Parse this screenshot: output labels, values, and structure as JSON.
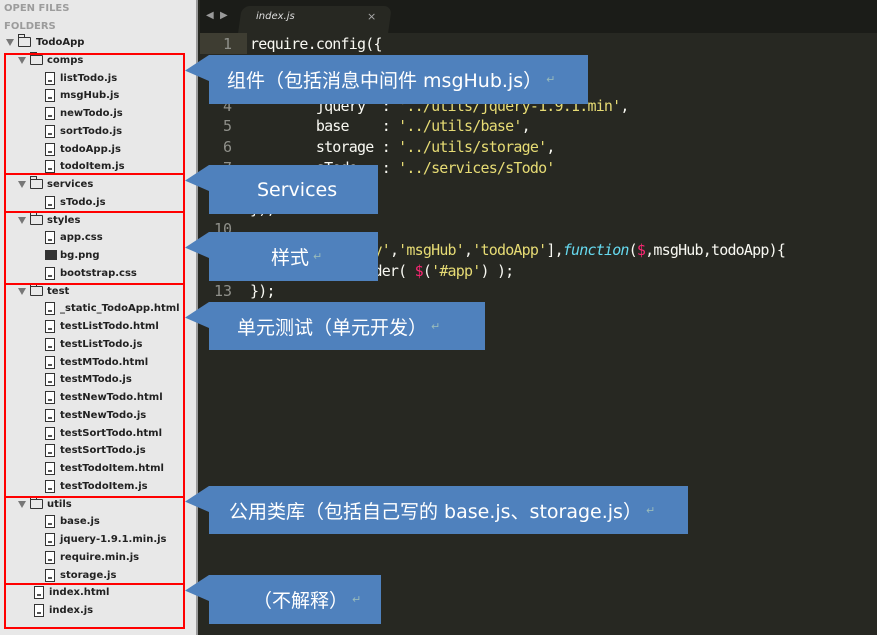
{
  "sidebar": {
    "open_files": "OPEN FILES",
    "folders": "FOLDERS",
    "tree": [
      {
        "name": "TodoApp",
        "type": "folder",
        "depth": 0
      },
      {
        "name": "comps",
        "type": "folder",
        "depth": 1
      },
      {
        "name": "listTodo.js",
        "type": "file",
        "depth": 2
      },
      {
        "name": "msgHub.js",
        "type": "file",
        "depth": 2
      },
      {
        "name": "newTodo.js",
        "type": "file",
        "depth": 2
      },
      {
        "name": "sortTodo.js",
        "type": "file",
        "depth": 2
      },
      {
        "name": "todoApp.js",
        "type": "file",
        "depth": 2
      },
      {
        "name": "todoItem.js",
        "type": "file",
        "depth": 2
      },
      {
        "name": "services",
        "type": "folder",
        "depth": 1
      },
      {
        "name": "sTodo.js",
        "type": "file",
        "depth": 2
      },
      {
        "name": "styles",
        "type": "folder",
        "depth": 1
      },
      {
        "name": "app.css",
        "type": "file",
        "depth": 2
      },
      {
        "name": "bg.png",
        "type": "image",
        "depth": 2
      },
      {
        "name": "bootstrap.css",
        "type": "file",
        "depth": 2
      },
      {
        "name": "test",
        "type": "folder",
        "depth": 1
      },
      {
        "name": "_static_TodoApp.html",
        "type": "file",
        "depth": 2
      },
      {
        "name": "testListTodo.html",
        "type": "file",
        "depth": 2
      },
      {
        "name": "testListTodo.js",
        "type": "file",
        "depth": 2
      },
      {
        "name": "testMTodo.html",
        "type": "file",
        "depth": 2
      },
      {
        "name": "testMTodo.js",
        "type": "file",
        "depth": 2
      },
      {
        "name": "testNewTodo.html",
        "type": "file",
        "depth": 2
      },
      {
        "name": "testNewTodo.js",
        "type": "file",
        "depth": 2
      },
      {
        "name": "testSortTodo.html",
        "type": "file",
        "depth": 2
      },
      {
        "name": "testSortTodo.js",
        "type": "file",
        "depth": 2
      },
      {
        "name": "testTodoItem.html",
        "type": "file",
        "depth": 2
      },
      {
        "name": "testTodoItem.js",
        "type": "file",
        "depth": 2
      },
      {
        "name": "utils",
        "type": "folder",
        "depth": 1
      },
      {
        "name": "base.js",
        "type": "file",
        "depth": 2
      },
      {
        "name": "jquery-1.9.1.min.js",
        "type": "file",
        "depth": 2
      },
      {
        "name": "require.min.js",
        "type": "file",
        "depth": 2
      },
      {
        "name": "storage.js",
        "type": "file",
        "depth": 2
      },
      {
        "name": "index.html",
        "type": "file",
        "depth": 1.5
      },
      {
        "name": "index.js",
        "type": "file",
        "depth": 1.5
      }
    ]
  },
  "editor": {
    "tab": "index.js",
    "close": "×",
    "nav_back": "◀",
    "nav_fwd": "▶",
    "lines": [
      {
        "n": "1",
        "t": [
          [
            "",
            "require.config({"
          ]
        ]
      },
      {
        "n": "2",
        "t": []
      },
      {
        "n": "3",
        "t": []
      },
      {
        "n": "4",
        "t": [
          [
            "",
            "        jquery  : "
          ],
          [
            "s",
            "'../utils/jquery-1.9.1.min'"
          ],
          [
            "",
            ","
          ]
        ]
      },
      {
        "n": "5",
        "t": [
          [
            "",
            "        base    : "
          ],
          [
            "s",
            "'../utils/base'"
          ],
          [
            "",
            ","
          ]
        ]
      },
      {
        "n": "6",
        "t": [
          [
            "",
            "        storage : "
          ],
          [
            "s",
            "'../utils/storage'"
          ],
          [
            "",
            ","
          ]
        ]
      },
      {
        "n": "7",
        "t": [
          [
            "",
            "        sTodo   : "
          ],
          [
            "s",
            "'../services/sTodo'"
          ]
        ]
      },
      {
        "n": "8",
        "t": []
      },
      {
        "n": "9",
        "t": [
          [
            "",
            "});"
          ]
        ]
      },
      {
        "n": "10",
        "t": []
      },
      {
        "n": "11",
        "t": [
          [
            "",
            "require(["
          ],
          [
            "s",
            "'jquery'"
          ],
          [
            "",
            ","
          ],
          [
            "s",
            "'msgHub'"
          ],
          [
            "",
            ","
          ],
          [
            "s",
            "'todoApp'"
          ],
          [
            "",
            "],"
          ],
          [
            "f",
            "function"
          ],
          [
            "",
            "("
          ],
          [
            "d",
            "$"
          ],
          [
            "",
            ",msgHub,todoApp){"
          ]
        ]
      },
      {
        "n": "12",
        "t": [
          [
            "",
            "    todoApp.render( "
          ],
          [
            "d",
            "$"
          ],
          [
            "",
            "("
          ],
          [
            "s",
            "'#app'"
          ],
          [
            "",
            ") );"
          ]
        ]
      },
      {
        "n": "13",
        "t": [
          [
            "",
            "});"
          ]
        ]
      }
    ]
  },
  "callouts": [
    "组件（包括消息中间件 msgHub.js）",
    "Services",
    "样式",
    "单元测试（单元开发）",
    "公用类库（包括自己写的 base.js、storage.js）",
    "（不解释）"
  ],
  "return_mark": "↵",
  "colors": {
    "callout": "#4f81bd",
    "highlight_box": "#ff0000",
    "editor_bg": "#272822"
  }
}
